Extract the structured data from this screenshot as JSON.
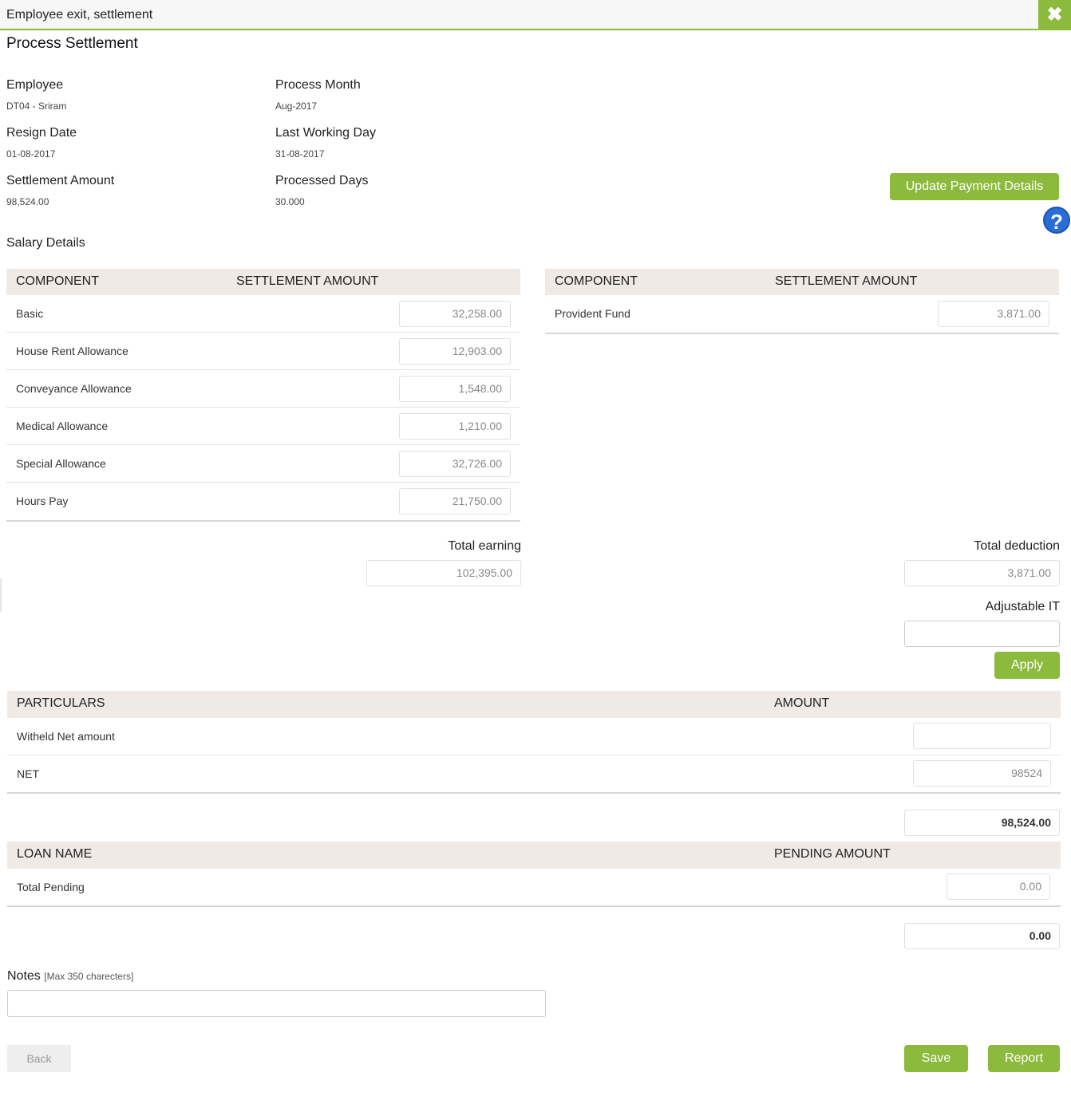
{
  "window": {
    "title": "Employee exit, settlement",
    "close_icon": "close-icon"
  },
  "page": {
    "title": "Process Settlement"
  },
  "info": {
    "employee_label": "Employee",
    "employee_value": "DT04 - Sriram",
    "process_month_label": "Process Month",
    "process_month_value": "Aug-2017",
    "resign_date_label": "Resign Date",
    "resign_date_value": "01-08-2017",
    "last_working_day_label": "Last Working Day",
    "last_working_day_value": "31-08-2017",
    "settlement_amount_label": "Settlement Amount",
    "settlement_amount_value": "98,524.00",
    "processed_days_label": "Processed Days",
    "processed_days_value": "30.000"
  },
  "actions": {
    "update_payment_label": "Update Payment Details",
    "help_icon": "help-icon",
    "apply_label": "Apply",
    "back_label": "Back",
    "save_label": "Save",
    "report_label": "Report"
  },
  "salary": {
    "section_label": "Salary Details",
    "earnings": {
      "col_component": "COMPONENT",
      "col_amount": "SETTLEMENT AMOUNT",
      "rows": [
        {
          "label": "Basic",
          "amount": "32,258.00"
        },
        {
          "label": "House Rent Allowance",
          "amount": "12,903.00"
        },
        {
          "label": "Conveyance Allowance",
          "amount": "1,548.00"
        },
        {
          "label": "Medical Allowance",
          "amount": "1,210.00"
        },
        {
          "label": "Special Allowance",
          "amount": "32,726.00"
        },
        {
          "label": "Hours Pay",
          "amount": "21,750.00"
        }
      ],
      "total_label": "Total earning",
      "total_value": "102,395.00"
    },
    "deductions": {
      "col_component": "COMPONENT",
      "col_amount": "SETTLEMENT AMOUNT",
      "rows": [
        {
          "label": "Provident Fund",
          "amount": "3,871.00"
        }
      ],
      "total_label": "Total deduction",
      "total_value": "3,871.00",
      "adjustable_it_label": "Adjustable IT",
      "adjustable_it_value": ""
    }
  },
  "particulars": {
    "col_particulars": "PARTICULARS",
    "col_amount": "AMOUNT",
    "rows": [
      {
        "label": "Witheld Net amount",
        "amount": ""
      },
      {
        "label": "NET",
        "amount": "98524"
      }
    ],
    "total": "98,524.00"
  },
  "loans": {
    "col_name": "LOAN NAME",
    "col_amount": "PENDING AMOUNT",
    "rows": [
      {
        "label": "Total Pending",
        "amount": "0.00"
      }
    ],
    "total": "0.00"
  },
  "notes": {
    "label": "Notes",
    "hint": "[Max 350 charecters]",
    "value": ""
  },
  "colors": {
    "accent": "#8cba3c",
    "header_bg": "#efeae6",
    "help_blue": "#2a6dd6"
  }
}
